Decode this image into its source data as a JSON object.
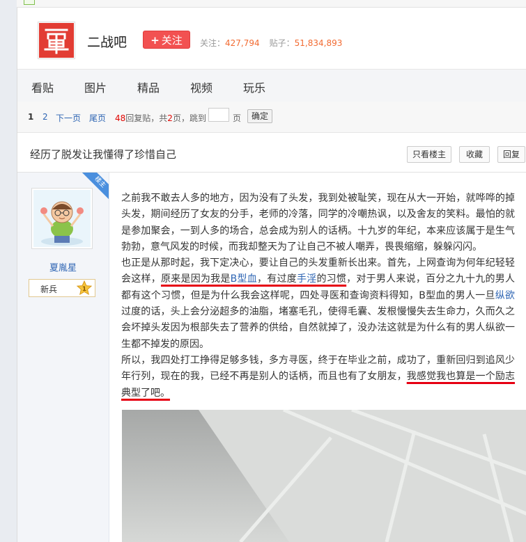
{
  "forum": {
    "name": "二战吧",
    "follow_label": "关注",
    "follow_plus": "+",
    "followers_label": "关注：",
    "followers": "427,794",
    "posts_label": "贴子：",
    "posts": "51,834,893"
  },
  "nav": {
    "tabs": [
      "看贴",
      "图片",
      "精品",
      "视频",
      "玩乐"
    ]
  },
  "pager": {
    "current": "1",
    "page2": "2",
    "next": "下一页",
    "last": "尾页",
    "reply_count": "48",
    "reply_text": "回复贴，共",
    "total_pages": "2",
    "pages_text": "页，跳到",
    "page_unit": "页",
    "confirm": "确定"
  },
  "thread": {
    "title": "经历了脱发让我懂得了珍惜自己",
    "only_op": "只看楼主",
    "favorite": "收藏",
    "reply": "回复"
  },
  "author": {
    "name": "夏胤星",
    "rank": "新兵",
    "level": "1",
    "badge": "楼主"
  },
  "post": {
    "p1": "之前我不敢去人多的地方，因为没有了头发，我到处被耻笑，现在从大一开始，就哗哗的掉头发，期间经历了女友的分手，老师的冷落，同学的冷嘲热讽，以及舍友的笑料。最怕的就是参加聚会，一到人多的场合，总会成为别人的话柄。十九岁的年纪，本来应该属于是生气勃勃，意气风发的时候，而我却整天为了让自己不被人嘲弄，畏畏缩缩，躲躲闪闪。",
    "p2a": "也正是从那时起，我下定决心，要让自己的头发重新长出来。首先，上网查询为何年纪轻轻会这样，",
    "p2b": "原来是因为我是",
    "p2c": "B型血",
    "p2d": "，有过度",
    "p2e": "手淫",
    "p2f": "的习惯",
    "p2g": "，对于男人来说，百分之九十九的男人都有这个习惯，但是为什么我会这样呢，四处寻医和查询资料得知，B型血的男人一旦",
    "p2h": "纵欲",
    "p2i": "过度的话，头上会分泌超多的油脂，堵塞毛孔，使得毛囊、发根慢慢失去生命力，久而久之会坏掉头发因为根部失去了营养的供给，自然就掉了，没办法这就是为什么有的男人纵欲一生都不掉发的原因。",
    "p3a": "所以，我四处打工挣得足够多钱，多方寻医，终于在毕业之前，成功了，重新回归到追风少年行列，现在的我，已经不再是别人的话柄，而且也有了女朋友，",
    "p3b": "我感觉我也算是一个励志典型了吧。"
  }
}
